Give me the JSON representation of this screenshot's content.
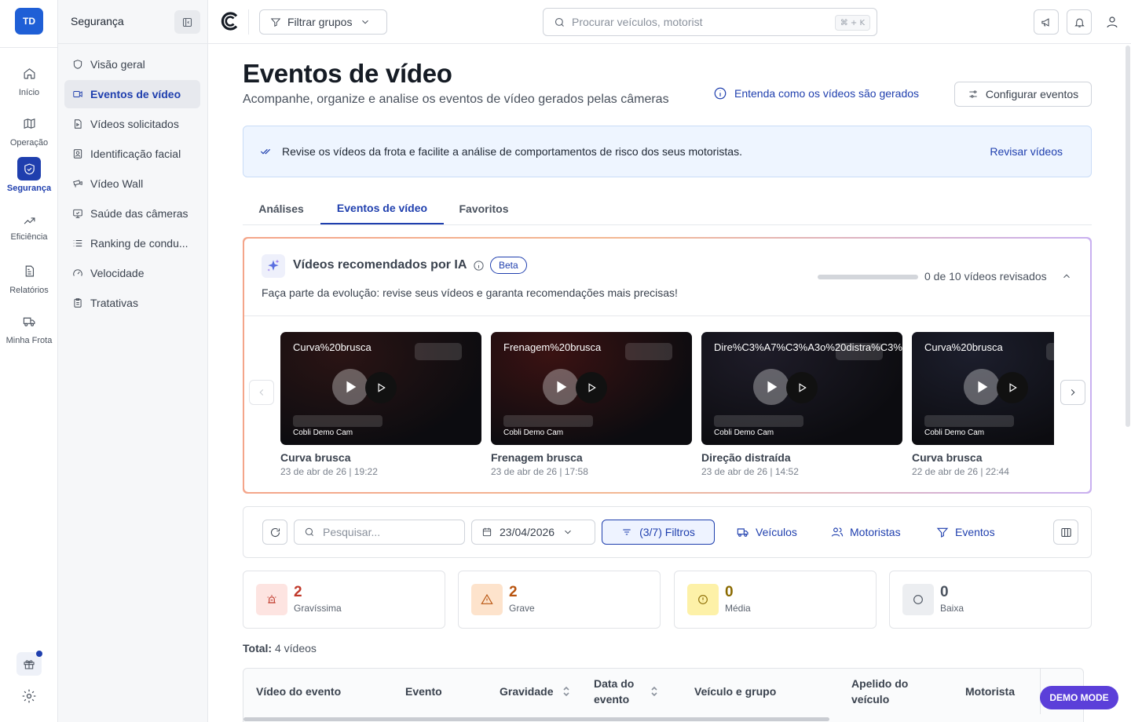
{
  "rail": {
    "logo": "TD",
    "items": [
      {
        "label": "Início",
        "icon": "home-icon"
      },
      {
        "label": "Operação",
        "icon": "map-icon"
      },
      {
        "label": "Segurança",
        "icon": "shield-icon",
        "active": true
      },
      {
        "label": "Eficiência",
        "icon": "trending-up-icon"
      },
      {
        "label": "Relatórios",
        "icon": "report-icon"
      },
      {
        "label": "Minha Frota",
        "icon": "truck-icon"
      }
    ]
  },
  "sidebar": {
    "title": "Segurança",
    "items": [
      {
        "label": "Visão geral",
        "icon": "shield-icon"
      },
      {
        "label": "Eventos de vídeo",
        "icon": "video-icon",
        "active": true
      },
      {
        "label": "Vídeos solicitados",
        "icon": "file-video-icon"
      },
      {
        "label": "Identificação facial",
        "icon": "face-id-icon"
      },
      {
        "label": "Vídeo Wall",
        "icon": "video-wall-icon"
      },
      {
        "label": "Saúde das câmeras",
        "icon": "monitor-icon"
      },
      {
        "label": "Ranking de condu...",
        "icon": "list-icon"
      },
      {
        "label": "Velocidade",
        "icon": "gauge-icon"
      },
      {
        "label": "Tratativas",
        "icon": "clipboard-icon"
      }
    ]
  },
  "topbar": {
    "filter_label": "Filtrar grupos",
    "search_placeholder": "Procurar veículos, motorist",
    "shortcut": "⌘ + K"
  },
  "page": {
    "title": "Eventos de vídeo",
    "subtitle": "Acompanhe, organize e analise os eventos de vídeo gerados pelas câmeras",
    "info_link": "Entenda como os vídeos são gerados",
    "config_button": "Configurar eventos",
    "banner_text": "Revise os vídeos da frota e facilite a análise de comportamentos de risco dos seus motoristas.",
    "banner_link": "Revisar vídeos",
    "tabs": [
      "Análises",
      "Eventos de vídeo",
      "Favoritos"
    ],
    "active_tab": 1
  },
  "ai_panel": {
    "title": "Vídeos recomendados por IA",
    "badge": "Beta",
    "description": "Faça parte da evolução: revise seus vídeos e garanta recomendações mais precisas!",
    "progress_text": "0 de 10 vídeos revisados",
    "progress_fraction": 0,
    "cards": [
      {
        "thumb_title": "Curva%20brusca",
        "camera": "Cobli Demo Cam",
        "title": "Curva brusca",
        "date": "23 de abr de 26 | 19:22",
        "bg": "#2a1414"
      },
      {
        "thumb_title": "Frenagem%20brusca",
        "camera": "Cobli Demo Cam",
        "title": "Frenagem brusca",
        "date": "23 de abr de 26 | 17:58",
        "bg": "#3a1212"
      },
      {
        "thumb_title": "Dire%C3%A7%C3%A3o%20distra%C3%ADda",
        "camera": "Cobli Demo Cam",
        "title": "Direção distraída",
        "date": "23 de abr de 26 | 14:52",
        "bg": "#1e1c28"
      },
      {
        "thumb_title": "Curva%20brusca",
        "camera": "Cobli Demo Cam",
        "title": "Curva brusca",
        "date": "22 de abr de 26 | 22:44",
        "bg": "#1c1e2c"
      }
    ]
  },
  "filters": {
    "search_placeholder": "Pesquisar...",
    "date": "23/04/2026",
    "filters_label": "(3/7) Filtros",
    "vehicles": "Veículos",
    "drivers": "Motoristas",
    "events": "Eventos"
  },
  "severity": [
    {
      "count": "2",
      "label": "Gravíssima",
      "color": "#c0392b",
      "bg": "#fde4e1",
      "icon": "siren-icon"
    },
    {
      "count": "2",
      "label": "Grave",
      "color": "#b8540f",
      "bg": "#fde3cc",
      "icon": "warning-icon"
    },
    {
      "count": "0",
      "label": "Média",
      "color": "#8a6a00",
      "bg": "#fdf1a8",
      "icon": "alert-circle-icon"
    },
    {
      "count": "0",
      "label": "Baixa",
      "color": "#4a525e",
      "bg": "#eceef1",
      "icon": "circle-icon"
    }
  ],
  "total": {
    "label": "Total:",
    "value": "4 vídeos"
  },
  "table": {
    "columns": [
      "Vídeo do evento",
      "Evento",
      "Gravidade",
      "Data do evento",
      "Veículo e grupo",
      "Apelido do veículo",
      "Motorista"
    ]
  },
  "demo_badge": "DEMO MODE"
}
